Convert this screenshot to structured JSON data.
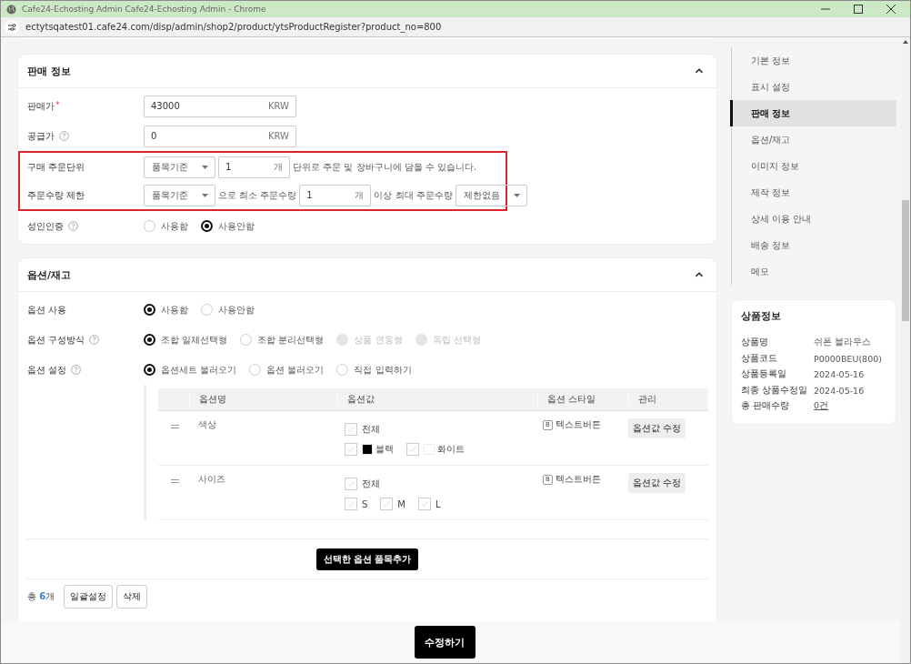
{
  "window": {
    "title": "Cafe24-Echosting Admin Cafe24-Echosting Admin - Chrome",
    "url": "ectytsqatest01.cafe24.com/disp/admin/shop2/product/ytsProductRegister?product_no=800"
  },
  "sales": {
    "title": "판매 정보",
    "expanded": true,
    "rows": [
      {
        "kind": "amount",
        "label": "판매가",
        "required_mark": "*",
        "help": false,
        "value": "43000",
        "unit": "KRW"
      },
      {
        "kind": "amount",
        "label": "공급가",
        "help": true,
        "value": "0",
        "unit": "KRW"
      },
      {
        "kind": "group",
        "highlighted": true,
        "rows": [
          {
            "kind": "order_unit",
            "label": "구매 주문단위",
            "help": false,
            "select": "품목기준",
            "value": "1",
            "unit": "개",
            "note": "단위로 주문 및 장바구니에 담을 수 있습니다."
          },
          {
            "kind": "order_limit",
            "label": "주문수량 제한",
            "help": false,
            "select": "품목기준",
            "text_1": "으로 최소 주문수량",
            "value": "1",
            "unit": "개",
            "text_2": "이상 최대 주문수량",
            "select_2": "제한없음"
          }
        ]
      },
      {
        "kind": "radio",
        "label": "성인인증",
        "help": true,
        "options": [
          {
            "label": "사용함",
            "selected": false,
            "disabled": false
          },
          {
            "label": "사용안함",
            "selected": true,
            "disabled": false
          }
        ]
      }
    ]
  },
  "options": {
    "title": "옵션/재고",
    "expanded": true,
    "rows": [
      {
        "kind": "radio",
        "label": "옵션 사용",
        "help": false,
        "options": [
          {
            "label": "사용함",
            "selected": true,
            "disabled": false
          },
          {
            "label": "사용안함",
            "selected": false,
            "disabled": false
          }
        ]
      },
      {
        "kind": "radio",
        "label": "옵션 구성방식",
        "help": true,
        "options": [
          {
            "label": "조합 일체선택형",
            "selected": true,
            "disabled": false
          },
          {
            "label": "조합 분리선택형",
            "selected": false,
            "disabled": false
          },
          {
            "label": "상품 연동형",
            "selected": false,
            "disabled": true
          },
          {
            "label": "독립 선택형",
            "selected": false,
            "disabled": true
          }
        ]
      },
      {
        "kind": "radio",
        "label": "옵션 설정",
        "help": true,
        "options": [
          {
            "label": "옵션세트 불러오기",
            "selected": true,
            "disabled": false
          },
          {
            "label": "옵션 불러오기",
            "selected": false,
            "disabled": false
          },
          {
            "label": "직접 입력하기",
            "selected": false,
            "disabled": false
          }
        ]
      }
    ],
    "table": {
      "columns": [
        "옵션명",
        "옵션값",
        "옵션 스타일",
        "관리"
      ],
      "rows": [
        {
          "name": "색상",
          "all": {
            "label": "전체",
            "checked": false
          },
          "values": [
            {
              "label": "블랙",
              "checked": false,
              "color": "#000000"
            },
            {
              "label": "화이트",
              "checked": false,
              "color": "#ffffff"
            }
          ],
          "style_badge": "B",
          "style": "텍스트버튼",
          "action": "옵션값 수정"
        },
        {
          "name": "사이즈",
          "all": {
            "label": "전체",
            "checked": false
          },
          "values": [
            {
              "label": "S",
              "checked": false
            },
            {
              "label": "M",
              "checked": false
            },
            {
              "label": "L",
              "checked": false
            }
          ],
          "style_badge": "B",
          "style": "텍스트버튼",
          "action": "옵션값 수정"
        }
      ]
    },
    "add_button": "선택한 옵션 품목추가",
    "total": {
      "label": "총",
      "count": "6",
      "unit": "개"
    },
    "buttons": [
      "일괄설정",
      "삭제"
    ]
  },
  "nav": {
    "items": [
      {
        "label": "기본 정보",
        "selected": false
      },
      {
        "label": "표시 설정",
        "selected": false
      },
      {
        "label": "판매 정보",
        "selected": true
      },
      {
        "label": "옵션/재고",
        "selected": false
      },
      {
        "label": "이미지 정보",
        "selected": false
      },
      {
        "label": "제작 정보",
        "selected": false
      },
      {
        "label": "상세 이용 안내",
        "selected": false
      },
      {
        "label": "배송 정보",
        "selected": false
      },
      {
        "label": "메모",
        "selected": false
      }
    ]
  },
  "product_info": {
    "title": "상품정보",
    "rows": [
      {
        "label": "상품명",
        "value": "쉬폰 블라우스",
        "linked": false
      },
      {
        "label": "상품코드",
        "value": "P0000BEU(800)",
        "linked": false
      },
      {
        "label": "상품등록일",
        "value": "2024-05-16",
        "linked": false
      },
      {
        "label": "최종 상품수정일",
        "value": "2024-05-16",
        "linked": false
      },
      {
        "label": "총 판매수량",
        "value": "0건",
        "linked": true
      }
    ]
  },
  "submit": "수정하기"
}
